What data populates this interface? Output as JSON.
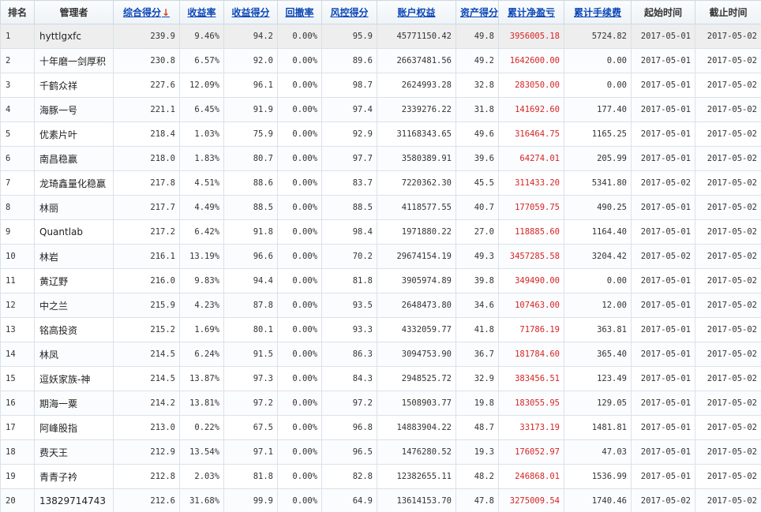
{
  "table": {
    "headers": [
      {
        "label": "排名",
        "sortable": false,
        "sorted": false
      },
      {
        "label": "管理者",
        "sortable": false,
        "sorted": false
      },
      {
        "label": "综合得分",
        "sortable": true,
        "sorted": true
      },
      {
        "label": "收益率",
        "sortable": true,
        "sorted": false
      },
      {
        "label": "收益得分",
        "sortable": true,
        "sorted": false
      },
      {
        "label": "回撤率",
        "sortable": true,
        "sorted": false
      },
      {
        "label": "风控得分",
        "sortable": true,
        "sorted": false
      },
      {
        "label": "账户权益",
        "sortable": true,
        "sorted": false
      },
      {
        "label": "资产得分",
        "sortable": true,
        "sorted": false
      },
      {
        "label": "累计净盈亏",
        "sortable": true,
        "sorted": false
      },
      {
        "label": "累计手续费",
        "sortable": true,
        "sorted": false
      },
      {
        "label": "起始时间",
        "sortable": false,
        "sorted": false
      },
      {
        "label": "截止时间",
        "sortable": false,
        "sorted": false
      }
    ],
    "sort_indicator": "↓",
    "colors": {
      "profit": "#d62424",
      "sortable_header": "#0b47b8",
      "sort_arrow": "#d63a2a",
      "selected_row": "#eeeeee"
    },
    "rows": [
      [
        "1",
        "hyttlgxfc",
        "239.9",
        "9.46%",
        "94.2",
        "0.00%",
        "95.9",
        "45771150.42",
        "49.8",
        "3956005.18",
        "5724.82",
        "2017-05-01",
        "2017-05-02"
      ],
      [
        "2",
        "十年磨一剑厚积",
        "230.8",
        "6.57%",
        "92.0",
        "0.00%",
        "89.6",
        "26637481.56",
        "49.2",
        "1642600.00",
        "0.00",
        "2017-05-01",
        "2017-05-02"
      ],
      [
        "3",
        "千鹤众祥",
        "227.6",
        "12.09%",
        "96.1",
        "0.00%",
        "98.7",
        "2624993.28",
        "32.8",
        "283050.00",
        "0.00",
        "2017-05-01",
        "2017-05-02"
      ],
      [
        "4",
        "海豚一号",
        "221.1",
        "6.45%",
        "91.9",
        "0.00%",
        "97.4",
        "2339276.22",
        "31.8",
        "141692.60",
        "177.40",
        "2017-05-01",
        "2017-05-02"
      ],
      [
        "5",
        "优素片叶",
        "218.4",
        "1.03%",
        "75.9",
        "0.00%",
        "92.9",
        "31168343.65",
        "49.6",
        "316464.75",
        "1165.25",
        "2017-05-01",
        "2017-05-02"
      ],
      [
        "6",
        "南昌稳赢",
        "218.0",
        "1.83%",
        "80.7",
        "0.00%",
        "97.7",
        "3580389.91",
        "39.6",
        "64274.01",
        "205.99",
        "2017-05-01",
        "2017-05-02"
      ],
      [
        "7",
        "龙琦鑫量化稳赢",
        "217.8",
        "4.51%",
        "88.6",
        "0.00%",
        "83.7",
        "7220362.30",
        "45.5",
        "311433.20",
        "5341.80",
        "2017-05-02",
        "2017-05-02"
      ],
      [
        "8",
        "林丽",
        "217.7",
        "4.49%",
        "88.5",
        "0.00%",
        "88.5",
        "4118577.55",
        "40.7",
        "177059.75",
        "490.25",
        "2017-05-01",
        "2017-05-02"
      ],
      [
        "9",
        "Quantlab",
        "217.2",
        "6.42%",
        "91.8",
        "0.00%",
        "98.4",
        "1971880.22",
        "27.0",
        "118885.60",
        "1164.40",
        "2017-05-01",
        "2017-05-02"
      ],
      [
        "10",
        "林岩",
        "216.1",
        "13.19%",
        "96.6",
        "0.00%",
        "70.2",
        "29674154.19",
        "49.3",
        "3457285.58",
        "3204.42",
        "2017-05-02",
        "2017-05-02"
      ],
      [
        "11",
        "黄辽野",
        "216.0",
        "9.83%",
        "94.4",
        "0.00%",
        "81.8",
        "3905974.89",
        "39.8",
        "349490.00",
        "0.00",
        "2017-05-01",
        "2017-05-02"
      ],
      [
        "12",
        "中之兰",
        "215.9",
        "4.23%",
        "87.8",
        "0.00%",
        "93.5",
        "2648473.80",
        "34.6",
        "107463.00",
        "12.00",
        "2017-05-01",
        "2017-05-02"
      ],
      [
        "13",
        "铭高投资",
        "215.2",
        "1.69%",
        "80.1",
        "0.00%",
        "93.3",
        "4332059.77",
        "41.8",
        "71786.19",
        "363.81",
        "2017-05-01",
        "2017-05-02"
      ],
      [
        "14",
        "林凤",
        "214.5",
        "6.24%",
        "91.5",
        "0.00%",
        "86.3",
        "3094753.90",
        "36.7",
        "181784.60",
        "365.40",
        "2017-05-01",
        "2017-05-02"
      ],
      [
        "15",
        "逗妖家族-神",
        "214.5",
        "13.87%",
        "97.3",
        "0.00%",
        "84.3",
        "2948525.72",
        "32.9",
        "383456.51",
        "123.49",
        "2017-05-01",
        "2017-05-02"
      ],
      [
        "16",
        "期海一粟",
        "214.2",
        "13.81%",
        "97.2",
        "0.00%",
        "97.2",
        "1508903.77",
        "19.8",
        "183055.95",
        "129.05",
        "2017-05-01",
        "2017-05-02"
      ],
      [
        "17",
        "阿峰股指",
        "213.0",
        "0.22%",
        "67.5",
        "0.00%",
        "96.8",
        "14883904.22",
        "48.7",
        "33173.19",
        "1481.81",
        "2017-05-01",
        "2017-05-02"
      ],
      [
        "18",
        "费天王",
        "212.9",
        "13.54%",
        "97.1",
        "0.00%",
        "96.5",
        "1476280.52",
        "19.3",
        "176052.97",
        "47.03",
        "2017-05-01",
        "2017-05-02"
      ],
      [
        "19",
        "青青子衿",
        "212.8",
        "2.03%",
        "81.8",
        "0.00%",
        "82.8",
        "12382655.11",
        "48.2",
        "246868.01",
        "1536.99",
        "2017-05-01",
        "2017-05-02"
      ],
      [
        "20",
        "13829714743",
        "212.6",
        "31.68%",
        "99.9",
        "0.00%",
        "64.9",
        "13614153.70",
        "47.8",
        "3275009.54",
        "1740.46",
        "2017-05-02",
        "2017-05-02"
      ]
    ]
  }
}
